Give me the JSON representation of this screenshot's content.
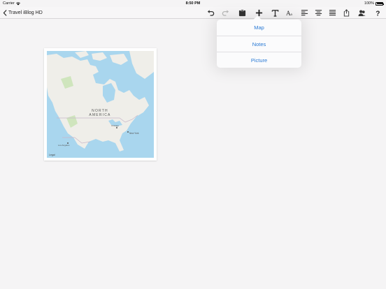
{
  "status_bar": {
    "carrier": "Carrier",
    "time": "8:50 PM",
    "battery_percent": "100%",
    "battery_level": 1.0
  },
  "nav": {
    "back_label": "Travel iBlog HD"
  },
  "toolbar": {
    "icons": [
      "undo-icon",
      "redo-icon",
      "clipboard-icon",
      "add-icon",
      "text-format-icon",
      "font-size-icon",
      "align-left-icon",
      "align-center-icon",
      "align-justify-icon",
      "share-icon",
      "users-icon",
      "help-icon"
    ]
  },
  "insert_menu": {
    "items": [
      "Map",
      "Notes",
      "Picture"
    ]
  },
  "map": {
    "region_line1": "NORTH",
    "region_line2": "AMERICA",
    "city_ny": "New York",
    "city_la": "Los Angeles",
    "city_chicago": "Chicago",
    "legal": "Legal",
    "colors": {
      "water": "#a9d6ee",
      "land": "#efeee9",
      "park": "#cfe5bd"
    }
  }
}
